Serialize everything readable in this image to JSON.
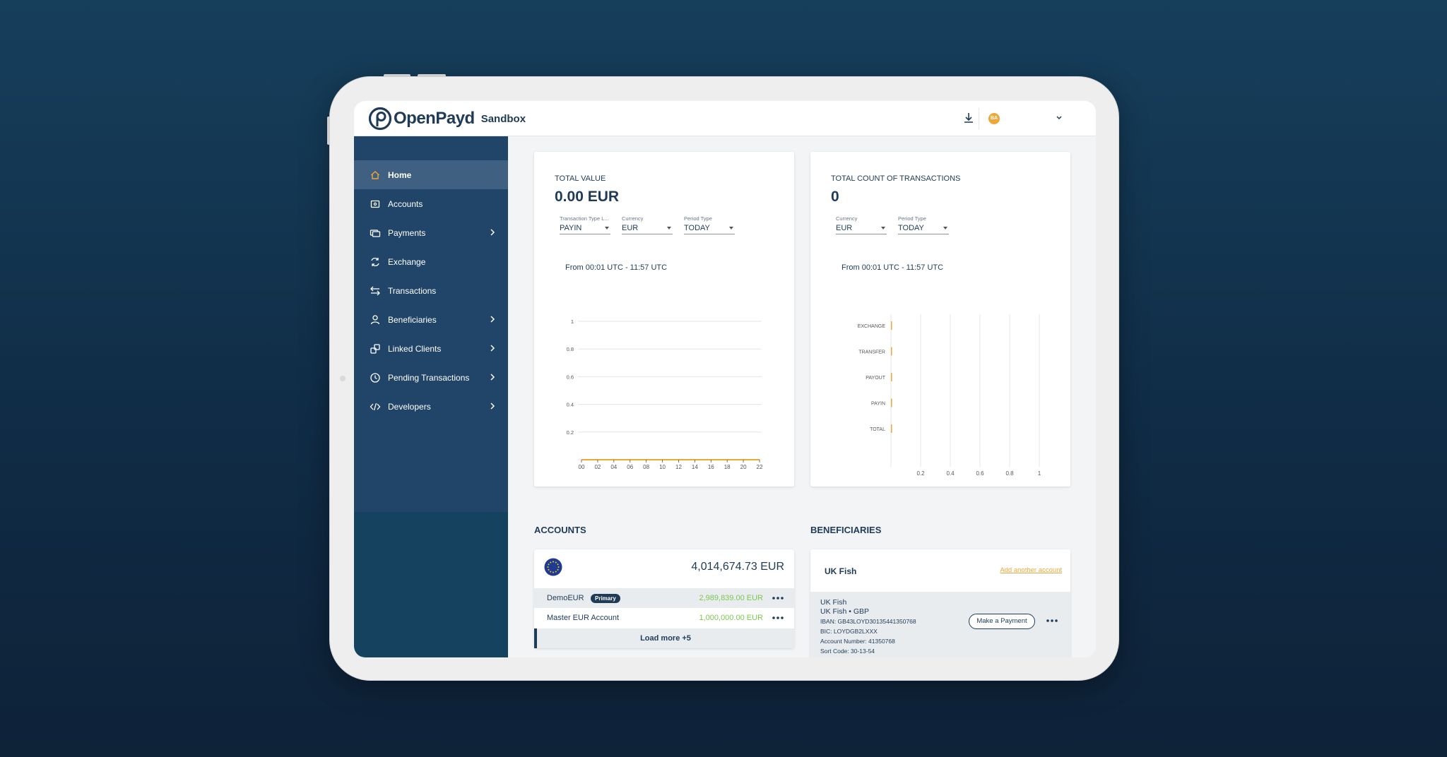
{
  "app": {
    "brand": "OpenPayd",
    "environment": "Sandbox",
    "avatar_initials": "BA"
  },
  "colors": {
    "accent": "#f0a73a",
    "navy": "#1f3b57",
    "sidebar": "#214568",
    "positive": "#7cc650"
  },
  "sidebar": {
    "items": [
      {
        "label": "Home",
        "icon": "home-icon",
        "active": true,
        "chevron": false
      },
      {
        "label": "Accounts",
        "icon": "wallet-icon",
        "active": false,
        "chevron": false
      },
      {
        "label": "Payments",
        "icon": "payments-icon",
        "active": false,
        "chevron": true
      },
      {
        "label": "Exchange",
        "icon": "exchange-icon",
        "active": false,
        "chevron": false
      },
      {
        "label": "Transactions",
        "icon": "transactions-icon",
        "active": false,
        "chevron": false
      },
      {
        "label": "Beneficiaries",
        "icon": "user-icon",
        "active": false,
        "chevron": true
      },
      {
        "label": "Linked Clients",
        "icon": "link-icon",
        "active": false,
        "chevron": true
      },
      {
        "label": "Pending Transactions",
        "icon": "clock-icon",
        "active": false,
        "chevron": true
      },
      {
        "label": "Developers",
        "icon": "code-icon",
        "active": false,
        "chevron": true
      }
    ]
  },
  "total_value": {
    "label": "TOTAL VALUE",
    "amount": "0.00 EUR",
    "filters": [
      {
        "label": "Transaction Type L...",
        "value": "PAYIN"
      },
      {
        "label": "Currency",
        "value": "EUR"
      },
      {
        "label": "Period Type",
        "value": "TODAY"
      }
    ],
    "range": "From 00:01 UTC - 11:57 UTC"
  },
  "total_count": {
    "label": "TOTAL COUNT OF TRANSACTIONS",
    "amount": "0",
    "filters": [
      {
        "label": "Currency",
        "value": "EUR"
      },
      {
        "label": "Period Type",
        "value": "TODAY"
      }
    ],
    "range": "From 00:01 UTC - 11:57 UTC"
  },
  "chart_data": [
    {
      "type": "line",
      "x": [
        "00",
        "02",
        "04",
        "06",
        "08",
        "10",
        "12",
        "14",
        "16",
        "18",
        "20",
        "22"
      ],
      "series": [
        {
          "values": [
            0,
            0,
            0,
            0,
            0,
            0,
            0,
            0,
            0,
            0,
            0,
            0
          ]
        }
      ],
      "yticks": [
        "0.2",
        "0.4",
        "0.6",
        "0.8",
        "1"
      ],
      "ylim": [
        0,
        1
      ],
      "grid": true
    },
    {
      "type": "bar",
      "orientation": "horizontal",
      "categories": [
        "EXCHANGE",
        "TRANSFER",
        "PAYOUT",
        "PAYIN",
        "TOTAL"
      ],
      "values": [
        0,
        0,
        0,
        0,
        0
      ],
      "xticks": [
        "0.2",
        "0.4",
        "0.6",
        "0.8",
        "1"
      ],
      "xlim": [
        0,
        1
      ],
      "grid": true
    }
  ],
  "accounts": {
    "title": "ACCOUNTS",
    "total": "4,014,674.73 EUR",
    "rows": [
      {
        "name": "DemoEUR",
        "badge": "Primary",
        "amount": "2,989,839.00 EUR"
      },
      {
        "name": "Master EUR Account",
        "amount": "1,000,000.00 EUR"
      }
    ],
    "load_more": "Load more +5"
  },
  "beneficiaries": {
    "title": "BENEFICIARIES",
    "name": "UK Fish",
    "add_link": "Add another account",
    "detail": {
      "line1": "UK Fish",
      "line2": "UK Fish  •  GBP",
      "iban": "IBAN: GB43LOYD30135441350768",
      "bic": "BIC: LOYDGB2LXXX",
      "account_number": "Account Number: 41350768",
      "sort_code": "Sort Code: 30-13-54"
    },
    "payment_button": "Make a Payment"
  }
}
